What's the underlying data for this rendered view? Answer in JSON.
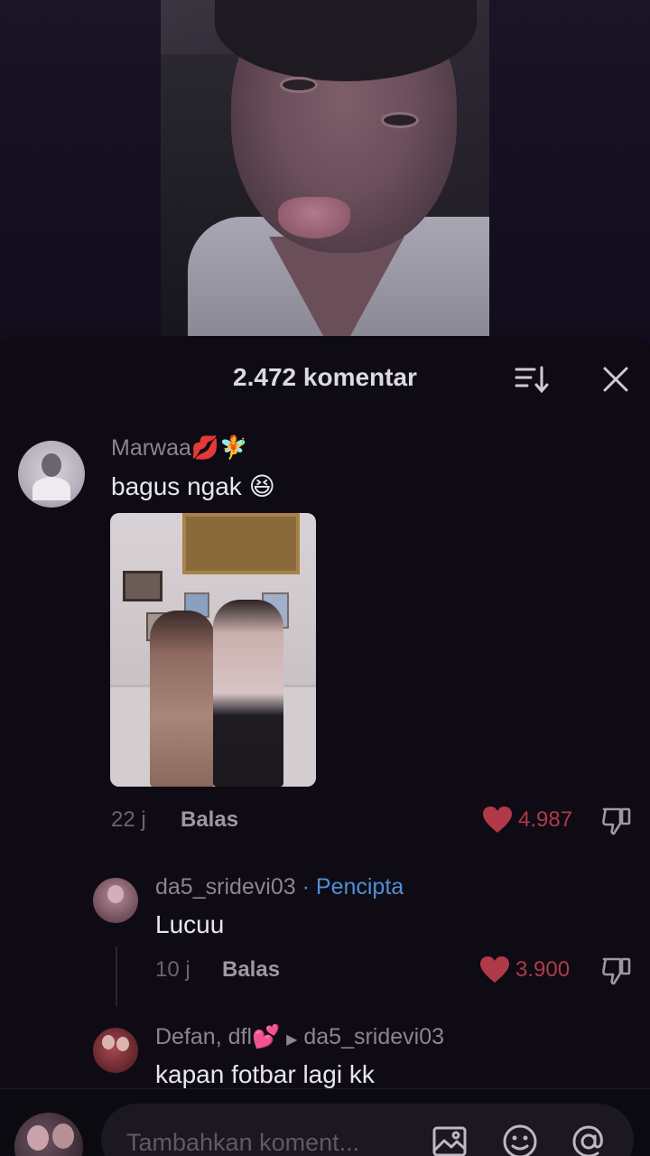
{
  "sheet": {
    "title": "2.472 komentar"
  },
  "comments": [
    {
      "username": "Marwaa💋🧚",
      "text": "bagus ngak 😆",
      "time": "22 j",
      "reply_label": "Balas",
      "likes": "4.987"
    },
    {
      "username": "da5_sridevi03",
      "creator_label": "· Pencipta",
      "text": "Lucuu",
      "time": "10 j",
      "reply_label": "Balas",
      "likes": "3.900"
    },
    {
      "username": "Defan, dfl💕",
      "reply_to": "da5_sridevi03",
      "text": "kapan fotbar lagi kk"
    }
  ],
  "input": {
    "placeholder": "Tambahkan koment..."
  },
  "colors": {
    "like_red": "#b03a48",
    "creator_blue": "#4f8fd6",
    "sheet_bg": "#0e0b14"
  },
  "icons": [
    "sort-icon",
    "close-icon",
    "heart-icon",
    "dislike-icon",
    "image-icon",
    "emoji-icon",
    "mention-icon"
  ]
}
